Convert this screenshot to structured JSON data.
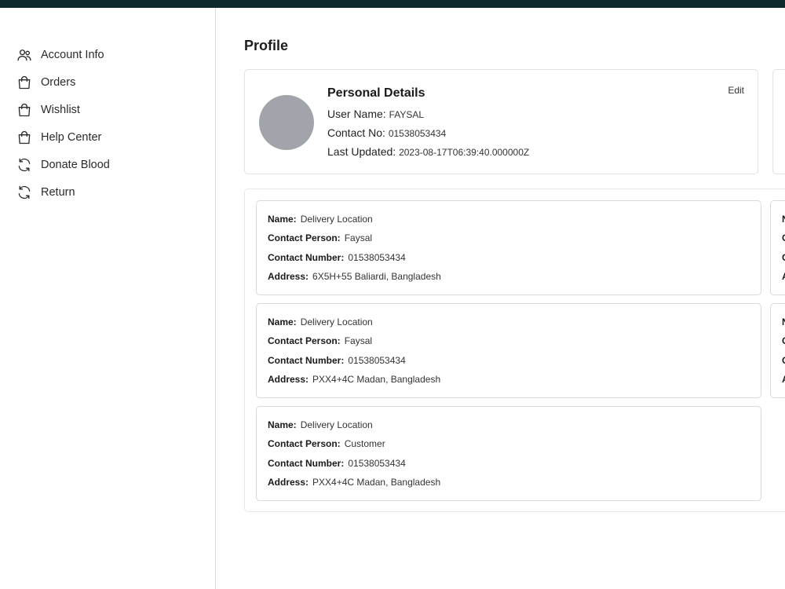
{
  "sidebar": {
    "items": [
      {
        "label": "Account Info",
        "icon": "users-icon"
      },
      {
        "label": "Orders",
        "icon": "shopping-bag-icon"
      },
      {
        "label": "Wishlist",
        "icon": "shopping-bag-icon"
      },
      {
        "label": "Help Center",
        "icon": "shopping-bag-icon"
      },
      {
        "label": "Donate Blood",
        "icon": "refresh-icon"
      },
      {
        "label": "Return",
        "icon": "refresh-icon"
      }
    ]
  },
  "main": {
    "title": "Profile",
    "personal": {
      "title": "Personal Details",
      "edit_label": "Edit",
      "user_name_label": "User Name:",
      "user_name": "FAYSAL",
      "contact_label": "Contact No:",
      "contact": "01538053434",
      "updated_label": "Last Updated:",
      "updated": "2023-08-17T06:39:40.000000Z"
    },
    "field_labels": {
      "name": "Name:",
      "person": "Contact Person:",
      "number": "Contact Number:",
      "address": "Address:"
    },
    "addresses": [
      {
        "name": "Delivery Location",
        "person": "Faysal",
        "number": "01538053434",
        "address": "6X5H+55 Baliardi, Bangladesh"
      },
      {
        "name": "Delivery Location",
        "person": "Faysal",
        "number": "01538053434",
        "address": "PXX4+4C Madan, Bangladesh"
      },
      {
        "name": "Delivery Location",
        "person": "Customer",
        "number": "01538053434",
        "address": "PXX4+4C Madan, Bangladesh"
      }
    ],
    "peek_letters": [
      "N",
      "C",
      "C",
      "A"
    ]
  },
  "colors": {
    "topbar": "#0f2a2a",
    "avatar": "#a1a4aa",
    "border": "#d9d9d9"
  }
}
